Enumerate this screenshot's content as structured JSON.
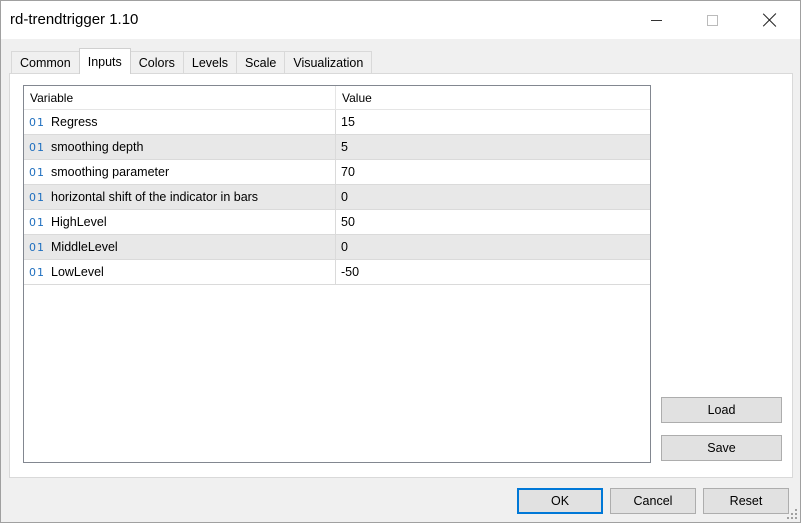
{
  "window": {
    "title": "rd-trendtrigger 1.10",
    "minimize_icon": "minimize-icon",
    "maximize_icon": "maximize-icon",
    "close_icon": "close-icon"
  },
  "tabs": [
    {
      "label": "Common",
      "active": false
    },
    {
      "label": "Inputs",
      "active": true
    },
    {
      "label": "Colors",
      "active": false
    },
    {
      "label": "Levels",
      "active": false
    },
    {
      "label": "Scale",
      "active": false
    },
    {
      "label": "Visualization",
      "active": false
    }
  ],
  "grid": {
    "columns": {
      "variable": "Variable",
      "value": "Value"
    },
    "type_icon_text": "01",
    "type_icon_color": "#1f6fbf",
    "rows": [
      {
        "variable": "Regress",
        "value": "15"
      },
      {
        "variable": "smoothing depth",
        "value": "5"
      },
      {
        "variable": "smoothing parameter",
        "value": "70"
      },
      {
        "variable": "horizontal shift of the indicator in bars",
        "value": "0"
      },
      {
        "variable": "HighLevel",
        "value": "50"
      },
      {
        "variable": "MiddleLevel",
        "value": "0"
      },
      {
        "variable": "LowLevel",
        "value": "-50"
      }
    ]
  },
  "side_buttons": {
    "load": "Load",
    "save": "Save"
  },
  "footer_buttons": {
    "ok": "OK",
    "cancel": "Cancel",
    "reset": "Reset"
  }
}
